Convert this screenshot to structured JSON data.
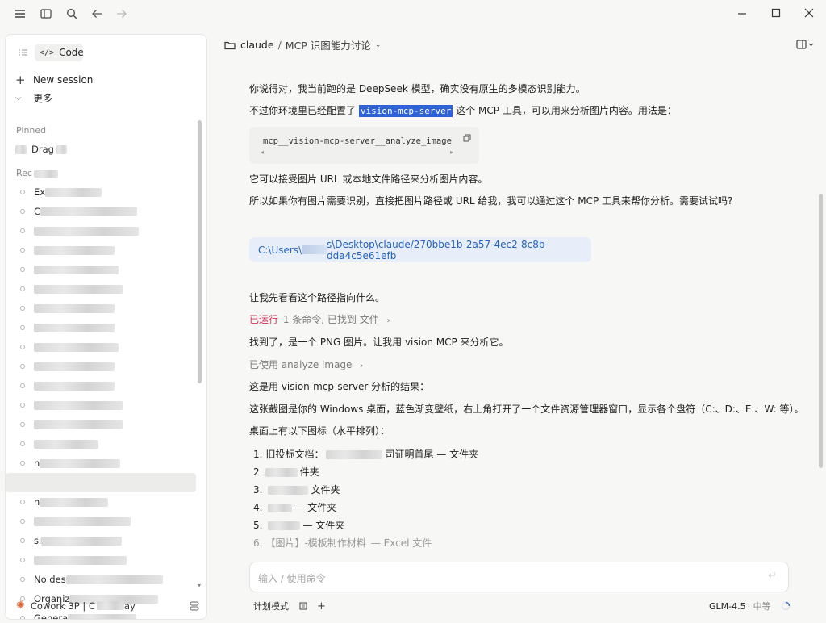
{
  "window": {
    "breadcrumb_project": "claude",
    "breadcrumb_sep": "/",
    "breadcrumb_title": "MCP 识图能力讨论"
  },
  "sidebar": {
    "code_tab": "Code",
    "new_session": "New session",
    "more": "更多",
    "pinned_label": "Pinned",
    "pinned_items": [
      "Drag"
    ],
    "recent_label": "Rec",
    "recent_items": [
      "Ex",
      "C",
      "",
      "",
      "",
      "",
      "",
      "",
      "",
      "",
      "",
      "",
      "",
      "",
      "n",
      "",
      "n",
      "",
      "si",
      "",
      "No des",
      "Organiz",
      "Genera"
    ],
    "footer": "Cowork 3P | C",
    "footer_tail": "ay"
  },
  "chat": {
    "p1": "你说得对，我当前跑的是 DeepSeek 模型，确实没有原生的多模态识别能力。",
    "p2_prefix": "不过你环境里已经配置了 ",
    "p2_highlight": "vision-mcp-server",
    "p2_suffix": " 这个 MCP 工具，可以用来分析图片内容。用法是：",
    "code": "mcp__vision-mcp-server__analyze_image",
    "p3": "它可以接受图片 URL 或本地文件路径来分析图片内容。",
    "p4": "所以如果你有图片需要识别，直接把图片路径或 URL 给我，我可以通过这个 MCP 工具来帮你分析。需要试试吗?",
    "user_path_a": "C:\\Users\\",
    "user_path_b": "s\\Desktop\\claude/270bbe1b-2a57-4ec2-8c8b-dda4c5e61efb",
    "p5": "让我先看看这个路径指向什么。",
    "ran_label": "已运行",
    "ran_detail": "1 条命令, 已找到 文件",
    "p6": "找到了，是一个 PNG 图片。让我用 vision MCP 来分析它。",
    "used_label": "已使用 analyze image",
    "p7": "这是用 vision-mcp-server 分析的结果：",
    "p8": "这张截图是你的 Windows 桌面，蓝色渐变壁纸，右上角打开了一个文件资源管理器窗口，显示各个盘符（C:、D:、E:、W: 等）。",
    "p9": "桌面上有以下图标（水平排列）：",
    "list": [
      {
        "num": "1.",
        "a": "旧投标文档：",
        "b": "司证明首尾 — 文件夹"
      },
      {
        "num": "2",
        "a": "",
        "b": "件夹"
      },
      {
        "num": "3.",
        "a": "",
        "b": "文件夹"
      },
      {
        "num": "4.",
        "a": "",
        "b": "— 文件夹"
      },
      {
        "num": "5.",
        "a": "",
        "b": "— 文件夹"
      },
      {
        "num": "6.",
        "a": "【图片】-模板制作材料",
        "b": "— Excel 文件"
      }
    ]
  },
  "composer": {
    "placeholder": "输入 / 使用命令",
    "plan_mode": "计划模式",
    "model": "GLM-4.5",
    "effort": "· 中等"
  }
}
